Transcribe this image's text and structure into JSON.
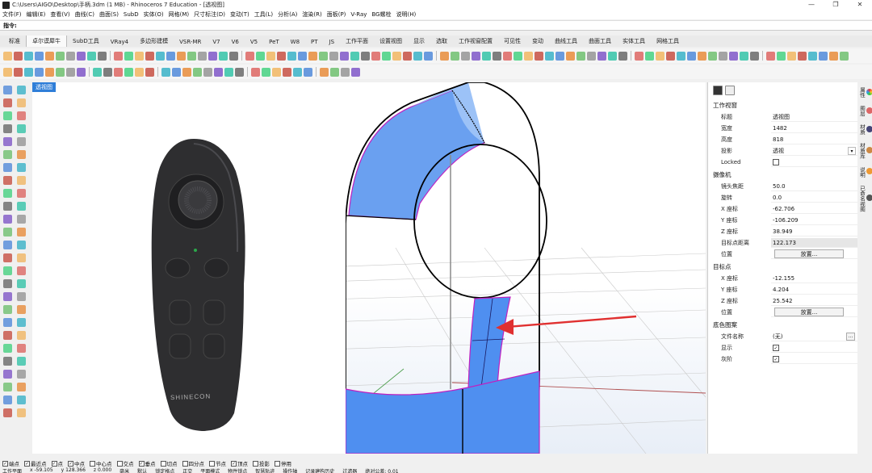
{
  "window": {
    "title": "C:\\Users\\AIGO\\Desktop\\手柄.3dm (1 MB) - Rhinoceros 7 Education - [透视图]",
    "minimize": "—",
    "maximize": "❐",
    "close": "✕"
  },
  "menu": [
    "文件(F)",
    "编辑(E)",
    "查看(V)",
    "曲线(C)",
    "曲面(S)",
    "SubD",
    "实体(O)",
    "网格(M)",
    "尺寸标注(D)",
    "变动(T)",
    "工具(L)",
    "分析(A)",
    "渲染(R)",
    "面板(P)",
    "V-Ray",
    "BG螺栓",
    "说明(H)"
  ],
  "command": {
    "label": "指令:"
  },
  "tabs": [
    "标准",
    "卓尔谟犀牛",
    "SubD工具",
    "VRay4",
    "多边形建模",
    "VSR-MR",
    "V7",
    "V6",
    "V5",
    "PeT",
    "W8",
    "PT",
    "JS",
    "工作平面",
    "设置视图",
    "显示",
    "选取",
    "工作视窗配置",
    "可见性",
    "变动",
    "曲线工具",
    "曲面工具",
    "实体工具",
    "网格工具"
  ],
  "active_tab": "卓尔谟犀牛",
  "viewport": {
    "label": "透视图",
    "brand": "SHINECON",
    "axis_z": "Z",
    "axis_y": "y",
    "axis_x": "x"
  },
  "properties": {
    "section_viewport": "工作视窗",
    "title_k": "标题",
    "title_v": "透视图",
    "width_k": "宽度",
    "width_v": "1482",
    "height_k": "高度",
    "height_v": "818",
    "projection_k": "投影",
    "projection_v": "透视",
    "locked_k": "Locked",
    "section_camera": "摄像机",
    "lens_k": "镜头焦距",
    "lens_v": "50.0",
    "rotation_k": "旋转",
    "rotation_v": "0.0",
    "cx_k": "X 座标",
    "cx_v": "-62.706",
    "cy_k": "Y 座标",
    "cy_v": "-106.209",
    "cz_k": "Z 座标",
    "cz_v": "38.949",
    "dist_k": "目标点距离",
    "dist_v": "122.173",
    "pos_k": "位置",
    "place_btn": "放置...",
    "section_target": "目标点",
    "tx_k": "X 座标",
    "tx_v": "-12.155",
    "ty_k": "Y 座标",
    "ty_v": "4.204",
    "tz_k": "Z 座标",
    "tz_v": "25.542",
    "tpos_k": "位置",
    "place_btn2": "放置...",
    "section_bg": "底色图案",
    "file_k": "文件名称",
    "file_v": "(无)",
    "show_k": "显示",
    "gray_k": "灰阶"
  },
  "right_tabs": [
    "属性",
    "图层",
    "材质",
    "材质库",
    "说明",
    "已命名视图"
  ],
  "osnap": [
    "端点",
    "最近点",
    "点",
    "中点",
    "中心点",
    "交点",
    "垂点",
    "切点",
    "四分点",
    "节点",
    "顶点",
    "投影",
    "停用"
  ],
  "status": [
    "工作平面",
    "x -59.105",
    "y 128.366",
    "z 0.000",
    "毫米",
    "默认",
    "锁定格点",
    "正交",
    "平面模式",
    "物件锁点",
    "智慧轨迹",
    "操作轴",
    "记录建构历史",
    "过滤器",
    "绝对公差: 0.01"
  ]
}
